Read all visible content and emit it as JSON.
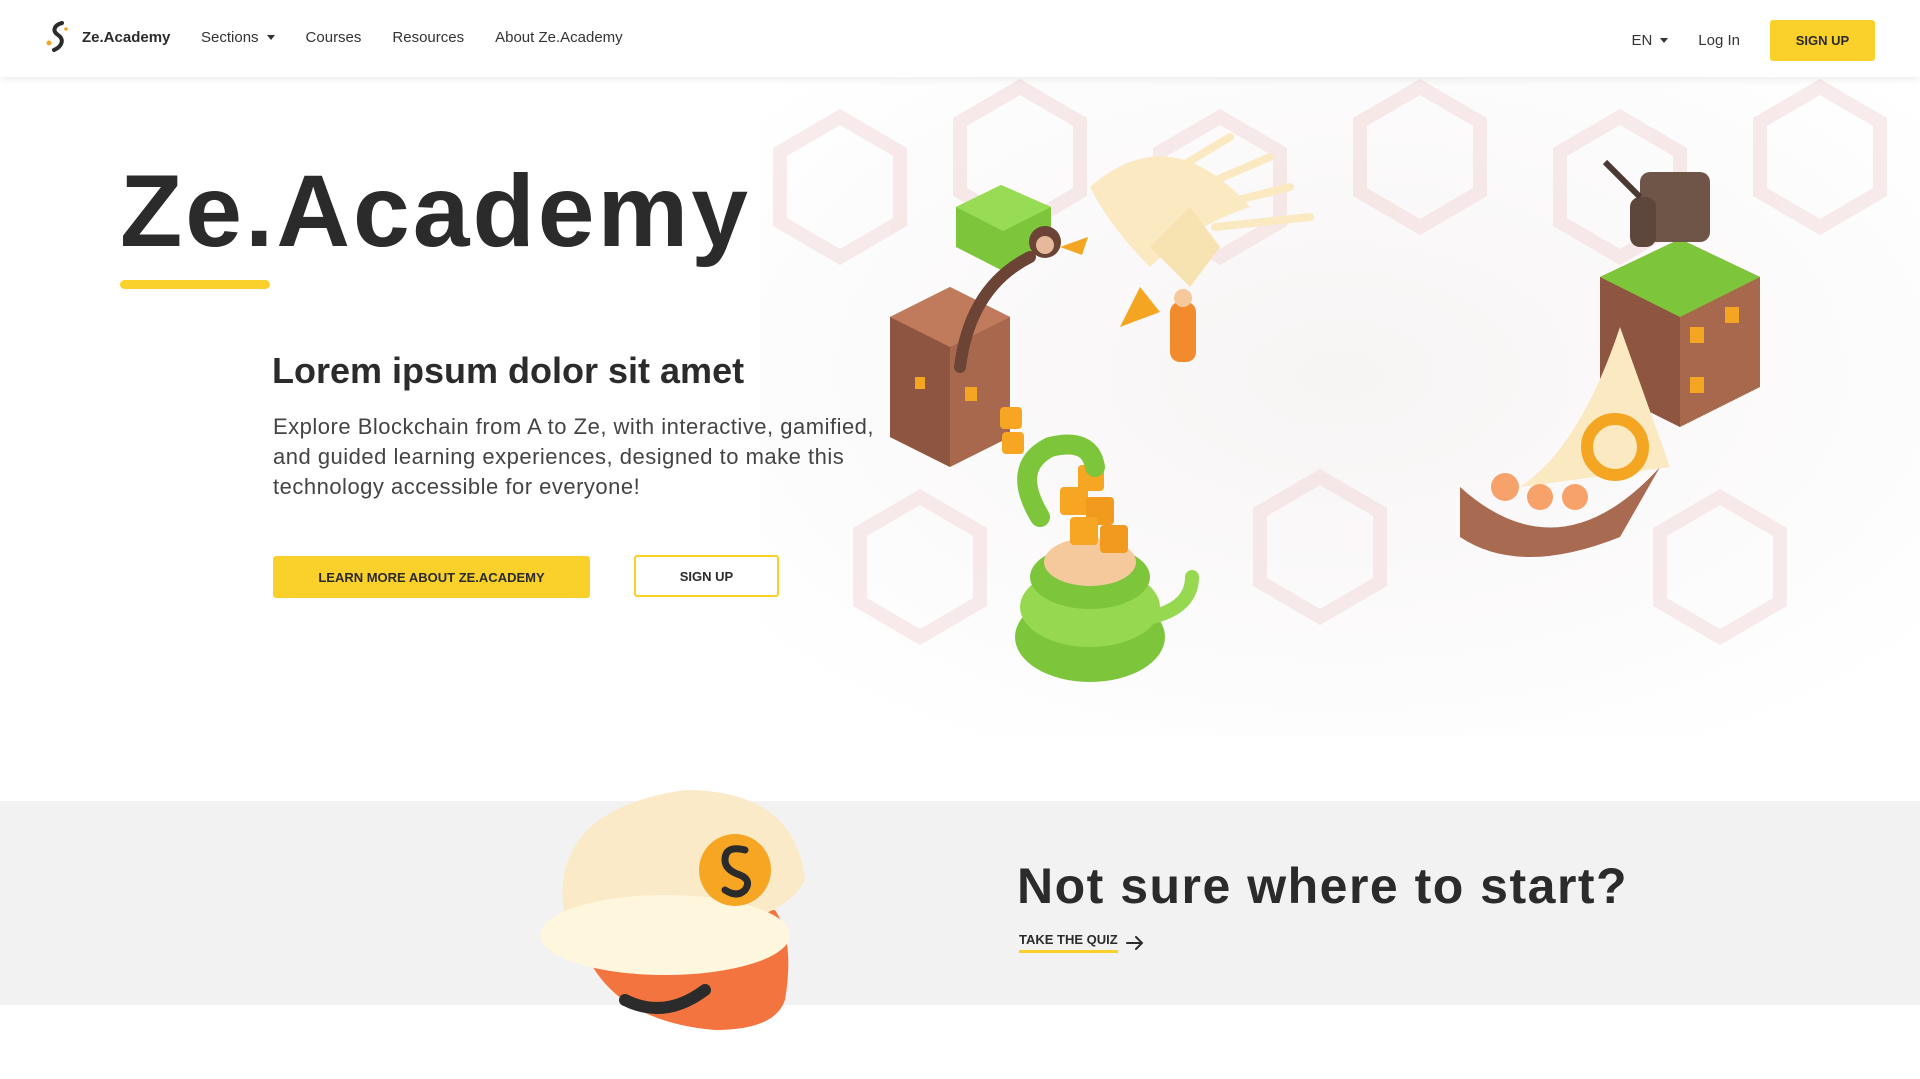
{
  "nav": {
    "brand": "Ze.Academy",
    "links": [
      {
        "label": "Sections",
        "dropdown": true
      },
      {
        "label": "Courses"
      },
      {
        "label": "Resources"
      },
      {
        "label": "About Ze.Academy"
      }
    ],
    "language": "EN",
    "login_label": "Log In",
    "signup_label": "SIGN UP"
  },
  "hero": {
    "title": "Ze.Academy",
    "subtitle": "Lorem ipsum dolor sit amet",
    "description": "Explore Blockchain from A to Ze, with interactive, gamified, and guided learning experiences, designed to make this technology accessible for everyone!",
    "learn_more_label": "LEARN MORE ABOUT ZE.ACADEMY",
    "signup_label": "SIGN UP"
  },
  "section2": {
    "title": "Not sure where to start?",
    "quiz_label": "TAKE THE QUIZ"
  },
  "colors": {
    "accent": "#f9d12a",
    "text": "#2b2b2b",
    "section_bg": "#f2f2f2"
  },
  "icons": {
    "logo": "ze-academy-logo-icon",
    "dropdown": "chevron-down-icon",
    "arrow": "arrow-right-icon"
  }
}
